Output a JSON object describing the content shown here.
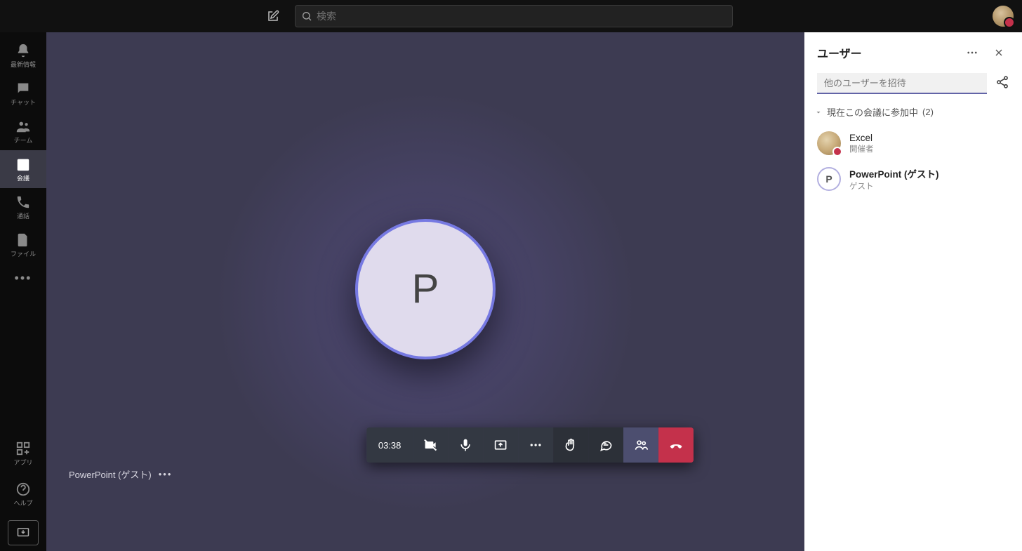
{
  "topbar": {
    "search_placeholder": "検索"
  },
  "rail": {
    "items": [
      {
        "key": "activity",
        "label": "最新情報"
      },
      {
        "key": "chat",
        "label": "チャット"
      },
      {
        "key": "teams",
        "label": "チーム"
      },
      {
        "key": "meetings",
        "label": "会議"
      },
      {
        "key": "calls",
        "label": "通話"
      },
      {
        "key": "files",
        "label": "ファイル"
      }
    ],
    "apps_label": "アプリ",
    "help_label": "ヘルプ"
  },
  "stage": {
    "avatar_initial": "P",
    "caller_label": "PowerPoint (ゲスト)"
  },
  "callbar": {
    "timer": "03:38"
  },
  "panel": {
    "title": "ユーザー",
    "invite_placeholder": "他のユーザーを招待",
    "section_label": "現在この会議に参加中",
    "section_count": "(2)",
    "participants": [
      {
        "name": "Excel",
        "role": "開催者",
        "avatar": "img",
        "bold": false,
        "badge": true
      },
      {
        "name": "PowerPoint (ゲスト)",
        "role": "ゲスト",
        "avatar": "P",
        "bold": true,
        "badge": false
      }
    ]
  }
}
